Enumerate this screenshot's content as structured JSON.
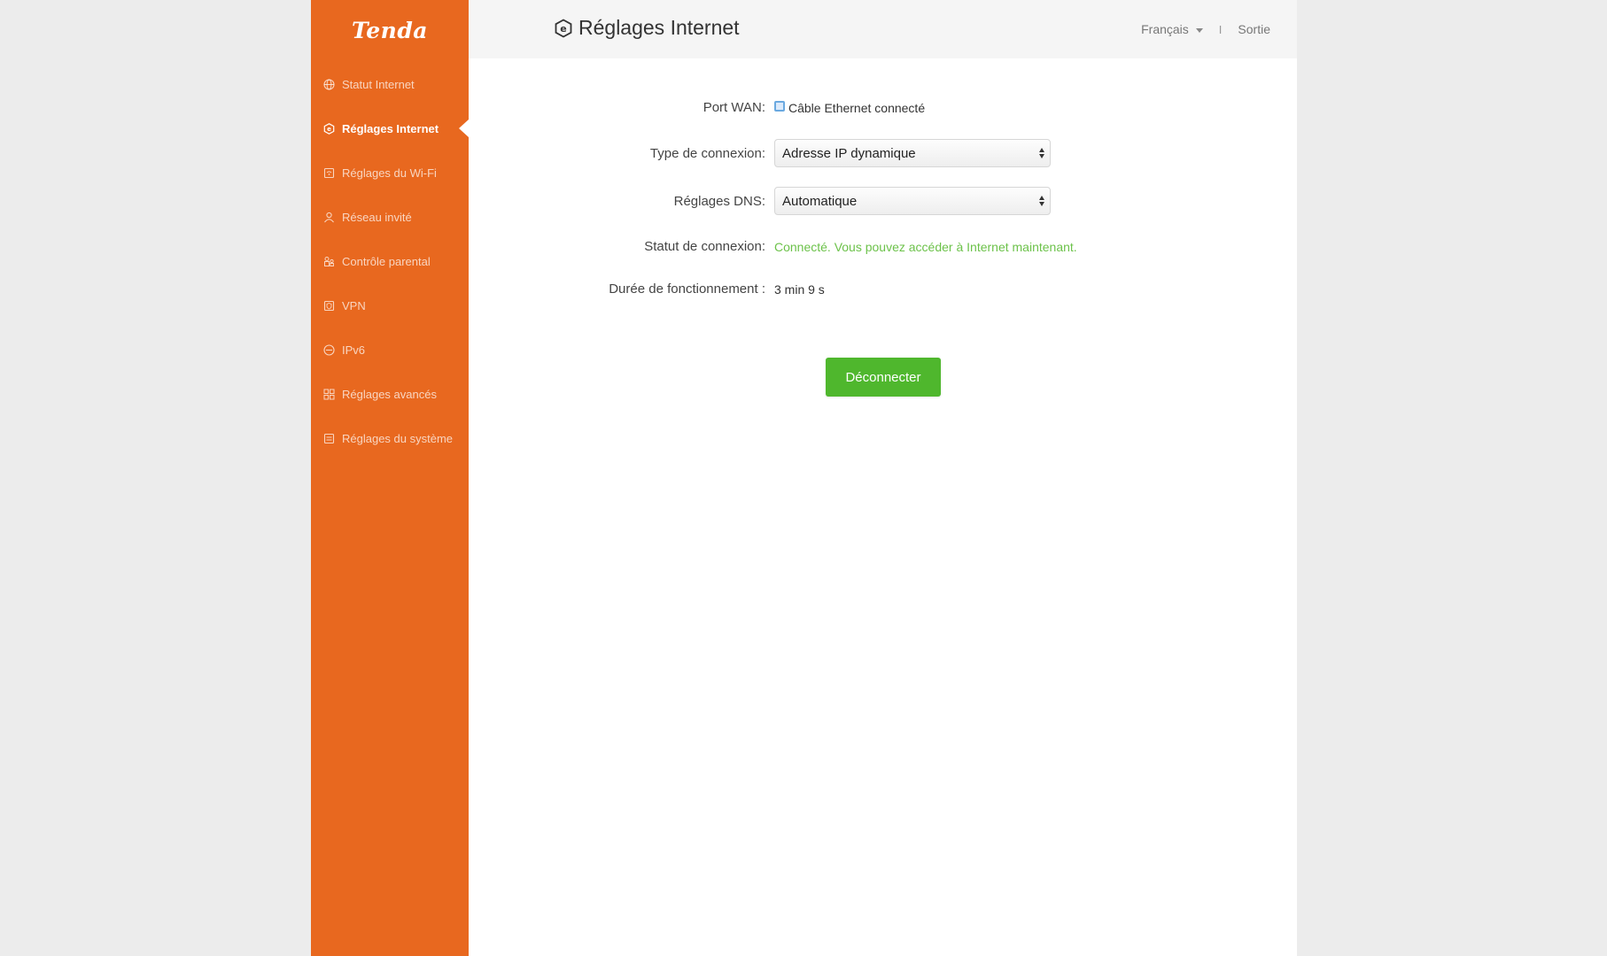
{
  "brand": {
    "logo_text": "Tenda",
    "accent_color": "#e8681f"
  },
  "sidebar": {
    "items": [
      {
        "label": "Statut Internet",
        "icon": "globe-icon",
        "active": false
      },
      {
        "label": "Réglages Internet",
        "icon": "settings-e-icon",
        "active": true
      },
      {
        "label": "Réglages du Wi-Fi",
        "icon": "wifi-icon",
        "active": false
      },
      {
        "label": "Réseau invité",
        "icon": "guest-user-icon",
        "active": false
      },
      {
        "label": "Contrôle parental",
        "icon": "parental-control-icon",
        "active": false
      },
      {
        "label": "VPN",
        "icon": "vpn-shield-icon",
        "active": false
      },
      {
        "label": "IPv6",
        "icon": "ipv6-icon",
        "active": false
      },
      {
        "label": "Réglages avancés",
        "icon": "grid-icon",
        "active": false
      },
      {
        "label": "Réglages du système",
        "icon": "system-icon",
        "active": false
      }
    ]
  },
  "header": {
    "title": "Réglages Internet",
    "title_icon": "settings-e-icon",
    "language": "Français",
    "separator": "I",
    "logout": "Sortie"
  },
  "form": {
    "wan_port": {
      "label": "Port WAN:",
      "value": "Câble Ethernet connecté",
      "icon": "ethernet-port-icon"
    },
    "connection_type": {
      "label": "Type de connexion:",
      "value": "Adresse IP dynamique"
    },
    "dns": {
      "label": "Réglages DNS:",
      "value": "Automatique"
    },
    "connection_status": {
      "label": "Statut de connexion:",
      "value": "Connecté. Vous pouvez accéder à Internet maintenant.",
      "color": "#6cc24a"
    },
    "uptime": {
      "label": "Durée de fonctionnement :",
      "value": "3 min 9 s"
    },
    "disconnect_button": {
      "label": "Déconnecter",
      "color": "#4fb72d"
    }
  }
}
